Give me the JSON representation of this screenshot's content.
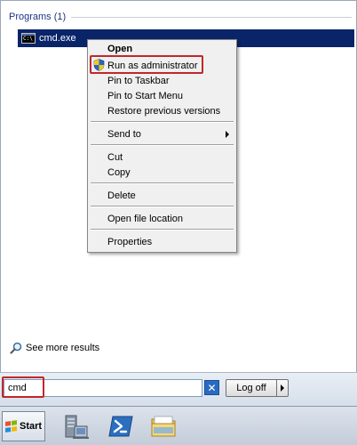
{
  "search_results": {
    "group_title": "Programs (1)",
    "items": [
      {
        "label": "cmd.exe",
        "icon": "cmd-icon"
      }
    ],
    "see_more": "See more results"
  },
  "context_menu": {
    "items": [
      {
        "label": "Open",
        "bold": true
      },
      {
        "label": "Run as administrator",
        "icon": "uac-shield-icon",
        "highlighted": true
      },
      {
        "label": "Pin to Taskbar"
      },
      {
        "label": "Pin to Start Menu"
      },
      {
        "label": "Restore previous versions"
      },
      {
        "label": "Send to",
        "submenu": true
      },
      {
        "label": "Cut"
      },
      {
        "label": "Copy"
      },
      {
        "label": "Delete"
      },
      {
        "label": "Open file location"
      },
      {
        "label": "Properties"
      }
    ]
  },
  "search_box": {
    "value": "cmd",
    "highlighted": true
  },
  "power": {
    "label": "Log off"
  },
  "taskbar": {
    "start_label": "Start",
    "pinned": [
      "server-manager-icon",
      "powershell-icon",
      "explorer-icon"
    ]
  },
  "colors": {
    "selection": "#0a246a",
    "highlight_border": "#c0282a",
    "menu_background": "#f0f0f0",
    "group_title": "#1e3287"
  }
}
